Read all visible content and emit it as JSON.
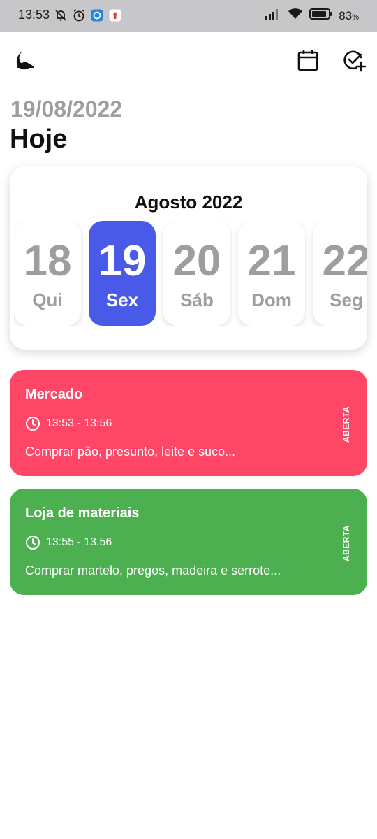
{
  "status_bar": {
    "time": "13:53",
    "battery_percent": "83",
    "battery_unit": "%"
  },
  "header": {
    "date_subtitle": "19/08/2022",
    "title": "Hoje",
    "icons": [
      "theme-toggle-icon",
      "calendar-icon",
      "add-task-icon"
    ]
  },
  "calendar": {
    "month_label": "Agosto 2022",
    "selected_index": 1,
    "days": [
      {
        "number": "18",
        "weekday": "Qui"
      },
      {
        "number": "19",
        "weekday": "Sex"
      },
      {
        "number": "20",
        "weekday": "Sáb"
      },
      {
        "number": "21",
        "weekday": "Dom"
      },
      {
        "number": "22",
        "weekday": "Seg"
      }
    ]
  },
  "tasks": [
    {
      "title": "Mercado",
      "time": "13:53 - 13:56",
      "description": "Comprar pão, presunto, leite e suco...",
      "status": "ABERTA",
      "color": "#ff4667"
    },
    {
      "title": "Loja de materiais",
      "time": "13:55 - 13:56",
      "description": "Comprar martelo, pregos, madeira e serrote...",
      "status": "ABERTA",
      "color": "#4caf50"
    }
  ],
  "colors": {
    "accent": "#4a5ae8",
    "subtitle_gray": "#9e9e9e"
  }
}
